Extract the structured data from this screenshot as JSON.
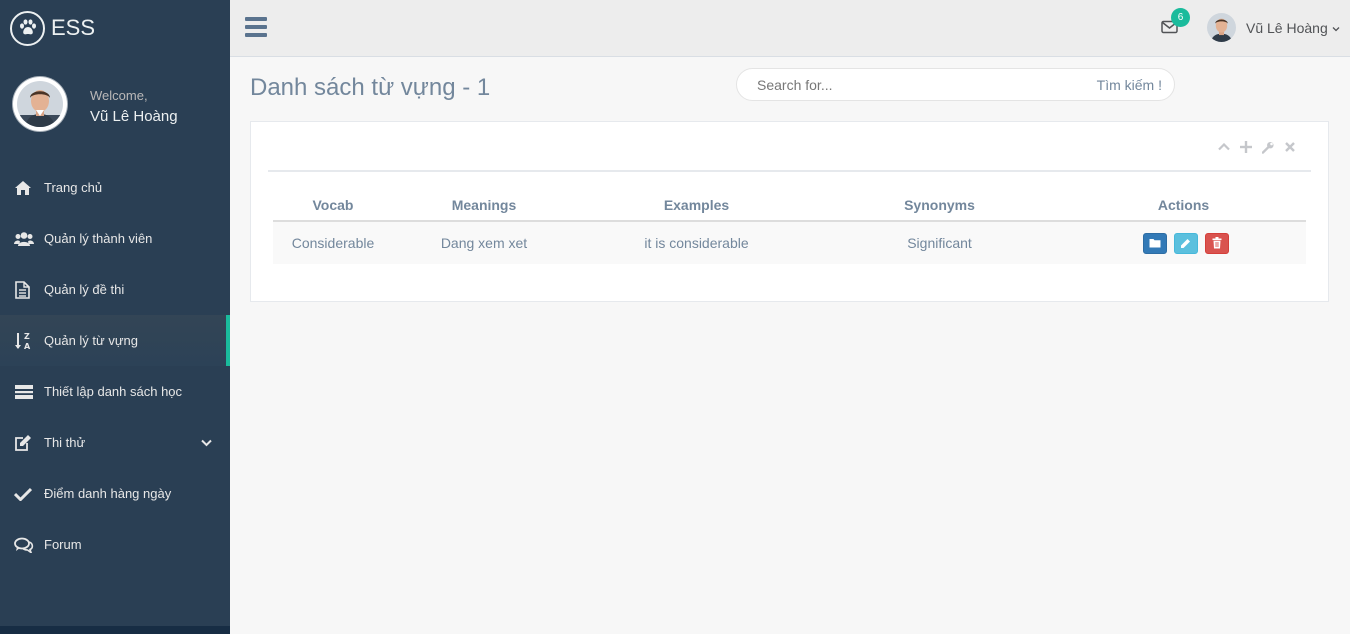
{
  "brand": {
    "name": "ESS",
    "icon": "paw-icon"
  },
  "profile": {
    "welcome": "Welcome,",
    "name": "Vũ Lê Hoàng"
  },
  "menu": {
    "items": [
      {
        "label": "Trang chủ",
        "icon": "home-icon"
      },
      {
        "label": "Quản lý thành viên",
        "icon": "users-icon"
      },
      {
        "label": "Quản lý đề thi",
        "icon": "document-icon"
      },
      {
        "label": "Quản lý từ vựng",
        "icon": "sort-alpha-icon",
        "active": true
      },
      {
        "label": "Thiết lập danh sách học",
        "icon": "list-icon"
      },
      {
        "label": "Thi thử",
        "icon": "edit-icon",
        "has_submenu": true
      },
      {
        "label": "Điểm danh hàng ngày",
        "icon": "check-icon"
      },
      {
        "label": "Forum",
        "icon": "comments-icon"
      }
    ]
  },
  "topnav": {
    "mail_count": "6",
    "user_name": "Vũ Lê Hoàng"
  },
  "page": {
    "title": "Danh sách từ vựng - 1"
  },
  "search": {
    "placeholder": "Search for...",
    "button_label": "Tìm kiếm !"
  },
  "table": {
    "headers": [
      "Vocab",
      "Meanings",
      "Examples",
      "Synonyms",
      "Actions"
    ],
    "rows": [
      {
        "vocab": "Considerable",
        "meanings": "Dang xem xet",
        "examples": "it is considerable",
        "synonyms": "Significant"
      }
    ]
  },
  "colors": {
    "sidebar_bg": "#2a3f54",
    "accent": "#1abb9c",
    "view_button": "#337ab7",
    "edit_button": "#5bc0de",
    "delete_button": "#d9534f"
  }
}
